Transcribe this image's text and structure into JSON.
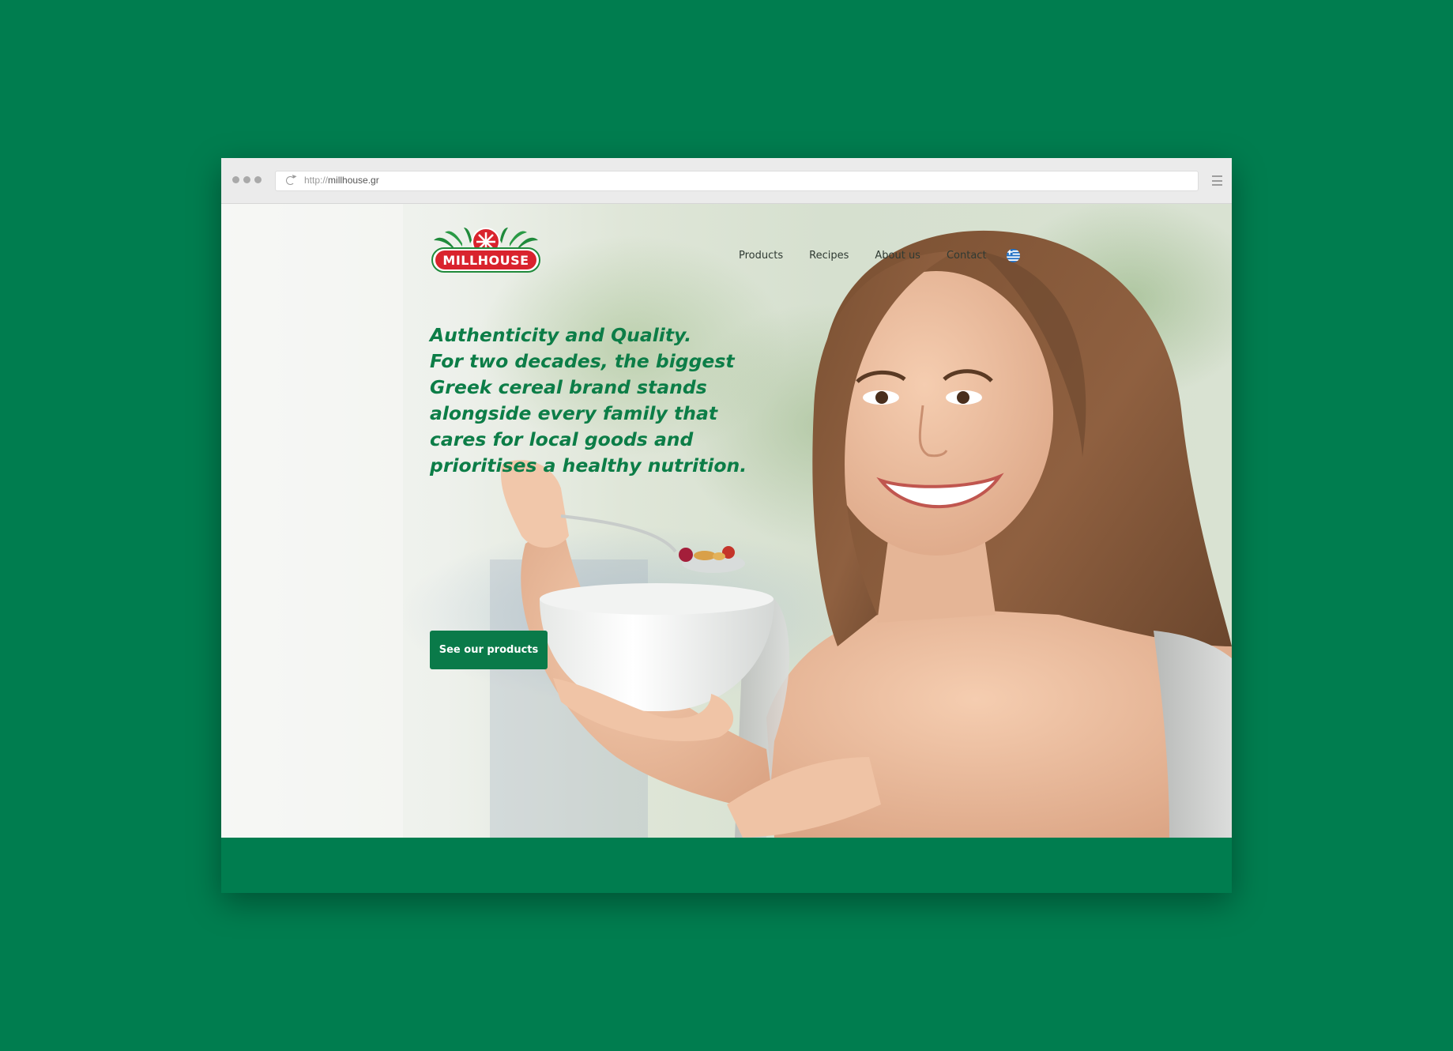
{
  "browser": {
    "url_protocol": "http://",
    "url_host": "millhouse.gr"
  },
  "site": {
    "logo_text": "MILLHOUSE",
    "nav": {
      "products": "Products",
      "recipes": "Recipes",
      "about": "About us",
      "contact": "Contact"
    },
    "language_flag": "greek-flag-icon"
  },
  "hero": {
    "headline_lines": [
      "Authenticity and Quality.",
      "For two decades, the biggest",
      "Greek cereal brand stands",
      "alongside every family that",
      "cares for local goods and",
      "prioritises a healthy nutrition."
    ],
    "cta_label": "See our products"
  },
  "colors": {
    "brand_green": "#0c7d47",
    "background_green": "#007d4f",
    "logo_red": "#d9232d"
  }
}
